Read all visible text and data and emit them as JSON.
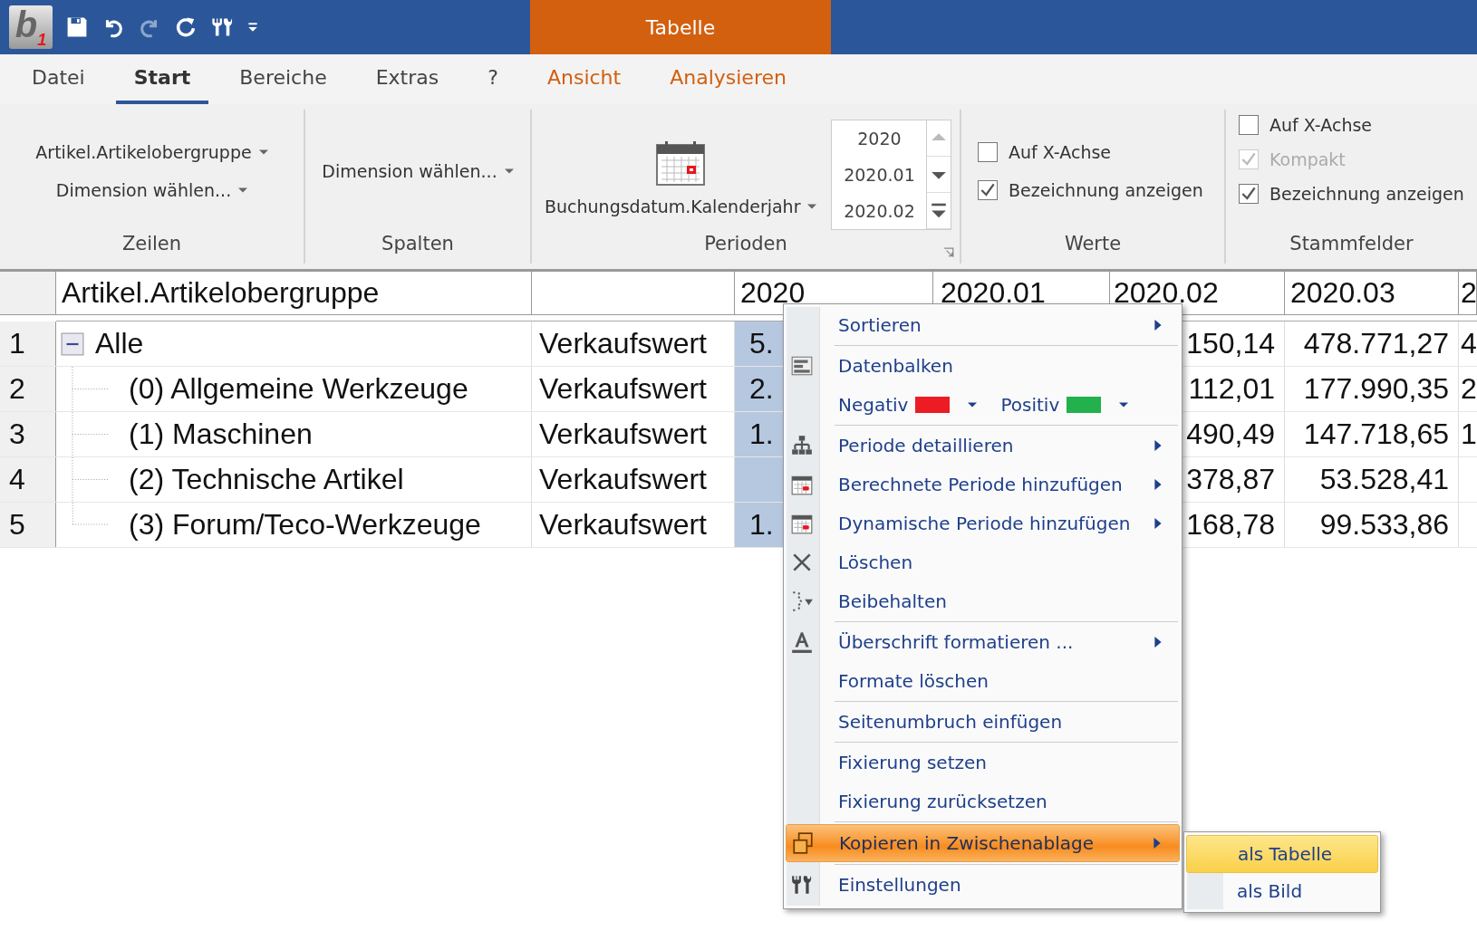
{
  "window": {
    "logo": "b$_{1}$",
    "context_tab": "Tabelle"
  },
  "ribbon_tabs": [
    {
      "label": "Datei",
      "selected": false,
      "contextual": false
    },
    {
      "label": "Start",
      "selected": true,
      "contextual": false
    },
    {
      "label": "Bereiche",
      "selected": false,
      "contextual": false
    },
    {
      "label": "Extras",
      "selected": false,
      "contextual": false
    },
    {
      "label": "?",
      "selected": false,
      "contextual": false
    },
    {
      "label": "Ansicht",
      "selected": false,
      "contextual": true
    },
    {
      "label": "Analysieren",
      "selected": false,
      "contextual": true
    }
  ],
  "ribbon": {
    "zeilen": {
      "label": "Zeilen",
      "dropdowns": [
        "Artikel.Artikelobergruppe",
        "Dimension wählen..."
      ]
    },
    "spalten": {
      "label": "Spalten",
      "dropdowns": [
        "Dimension wählen..."
      ]
    },
    "perioden": {
      "label": "Perioden",
      "dropdown": "Buchungsdatum.Kalenderjahr",
      "periods": [
        "2020",
        "2020.01",
        "2020.02"
      ]
    },
    "werte": {
      "label": "Werte",
      "checkboxes": [
        {
          "label": "Auf X-Achse",
          "checked": false,
          "disabled": false
        },
        {
          "label": "Bezeichnung anzeigen",
          "checked": true,
          "disabled": false
        }
      ]
    },
    "stammfelder": {
      "label": "Stammfelder",
      "checkboxes": [
        {
          "label": "Auf X-Achse",
          "checked": false,
          "disabled": false
        },
        {
          "label": "Kompakt",
          "checked": true,
          "disabled": true
        },
        {
          "label": "Bezeichnung anzeigen",
          "checked": true,
          "disabled": false
        }
      ]
    }
  },
  "table": {
    "columns": [
      "Artikel.Artikelobergruppe",
      "",
      "2020",
      "2020.01",
      "2020.02",
      "2020.03",
      "2"
    ],
    "rows": [
      {
        "number": "1",
        "expanded": true,
        "cells": [
          "Alle",
          "Verkaufswert",
          "5.",
          "",
          "150,14",
          "478.771,27",
          "4"
        ],
        "children": [
          {
            "number": "2",
            "cells": [
              "(0) Allgemeine Werkzeuge",
              "Verkaufswert",
              "2.",
              "",
              "112,01",
              "177.990,35",
              "2"
            ]
          },
          {
            "number": "3",
            "cells": [
              "(1) Maschinen",
              "Verkaufswert",
              "1.",
              "",
              "490,49",
              "147.718,65",
              "1"
            ]
          },
          {
            "number": "4",
            "cells": [
              "(2) Technische Artikel",
              "Verkaufswert",
              "",
              "",
              "378,87",
              "53.528,41",
              ""
            ]
          },
          {
            "number": "5",
            "cells": [
              "(3) Forum/Teco-Werkzeuge",
              "Verkaufswert",
              "1.",
              "",
              "168,78",
              "99.533,86",
              ""
            ]
          }
        ]
      }
    ]
  },
  "context_menu": {
    "items": [
      {
        "kind": "item",
        "label": "Sortieren",
        "submenu": true,
        "highlighted": false,
        "separator_after": true
      },
      {
        "kind": "item",
        "label": "Datenbalken",
        "submenu": false,
        "highlighted": false,
        "separator_after": false
      },
      {
        "kind": "colors",
        "swatches": [
          {
            "label": "Negativ",
            "color": "#ed1c24"
          },
          {
            "label": "Positiv",
            "color": "#22b14c"
          }
        ],
        "separator_after": true
      },
      {
        "kind": "item",
        "label": "Periode detaillieren",
        "submenu": true,
        "highlighted": false,
        "separator_after": false
      },
      {
        "kind": "item",
        "label": "Berechnete Periode hinzufügen",
        "submenu": true,
        "highlighted": false,
        "separator_after": false
      },
      {
        "kind": "item",
        "label": "Dynamische Periode hinzufügen",
        "submenu": true,
        "highlighted": false,
        "separator_after": false
      },
      {
        "kind": "item",
        "label": "Löschen",
        "submenu": false,
        "highlighted": false,
        "separator_after": false
      },
      {
        "kind": "item",
        "label": "Beibehalten",
        "submenu": false,
        "highlighted": false,
        "separator_after": true
      },
      {
        "kind": "item",
        "label": "Überschrift formatieren ...",
        "submenu": true,
        "highlighted": false,
        "separator_after": false
      },
      {
        "kind": "item",
        "label": "Formate löschen",
        "submenu": false,
        "highlighted": false,
        "separator_after": true
      },
      {
        "kind": "item",
        "label": "Seitenumbruch einfügen",
        "submenu": false,
        "highlighted": false,
        "separator_after": true
      },
      {
        "kind": "item",
        "label": "Fixierung setzen",
        "submenu": false,
        "highlighted": false,
        "separator_after": false
      },
      {
        "kind": "item",
        "label": "Fixierung zurücksetzen",
        "submenu": false,
        "highlighted": false,
        "separator_after": true
      },
      {
        "kind": "item",
        "label": "Kopieren in Zwischenablage",
        "submenu": true,
        "highlighted": true,
        "separator_after": true
      },
      {
        "kind": "item",
        "label": "Einstellungen",
        "submenu": false,
        "highlighted": false,
        "separator_after": false
      }
    ],
    "submenu": [
      {
        "label": "als Tabelle",
        "selected": true
      },
      {
        "label": "als Bild",
        "selected": false
      }
    ]
  }
}
